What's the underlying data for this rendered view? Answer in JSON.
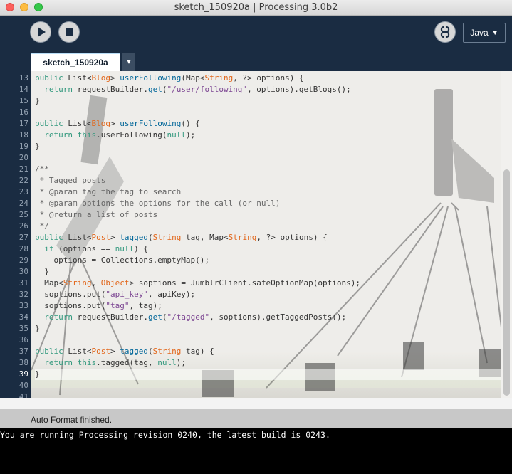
{
  "window": {
    "title": "sketch_150920a | Processing 3.0b2"
  },
  "toolbar": {
    "run_icon": "play-icon",
    "stop_icon": "stop-icon",
    "mode_icon": "debug-icon",
    "language": "Java"
  },
  "tab": {
    "name": "sketch_150920a",
    "menu_glyph": "▾"
  },
  "editor": {
    "current_line": 39,
    "lines": [
      {
        "n": "13",
        "html": "<span class=\"kw\">public</span> List&lt;<span class=\"ty\">Blog</span>&gt; <span class=\"fn\">userFollowing</span>(Map&lt;<span class=\"ty\">String</span>, ?&gt; options) {"
      },
      {
        "n": "14",
        "html": "  <span class=\"kw\">return</span> requestBuilder.<span class=\"fn\">get</span>(<span class=\"str\">\"/user/following\"</span>, options).getBlogs();"
      },
      {
        "n": "15",
        "html": "}"
      },
      {
        "n": "16",
        "html": ""
      },
      {
        "n": "17",
        "html": "<span class=\"kw\">public</span> List&lt;<span class=\"ty\">Blog</span>&gt; <span class=\"fn\">userFollowing</span>() {"
      },
      {
        "n": "18",
        "html": "  <span class=\"kw\">return</span> <span class=\"kw\">this</span>.userFollowing(<span class=\"lit\">null</span>);"
      },
      {
        "n": "19",
        "html": "}"
      },
      {
        "n": "20",
        "html": ""
      },
      {
        "n": "21",
        "html": "<span class=\"com\">/**</span>"
      },
      {
        "n": "22",
        "html": "<span class=\"com\"> * Tagged posts</span>"
      },
      {
        "n": "23",
        "html": "<span class=\"com\"> * @param tag the tag to search</span>"
      },
      {
        "n": "24",
        "html": "<span class=\"com\"> * @param options the options for the call (or null)</span>"
      },
      {
        "n": "25",
        "html": "<span class=\"com\"> * @return a list of posts</span>"
      },
      {
        "n": "26",
        "html": "<span class=\"com\"> */</span>"
      },
      {
        "n": "27",
        "html": "<span class=\"kw\">public</span> List&lt;<span class=\"ty\">Post</span>&gt; <span class=\"fn\">tagged</span>(<span class=\"ty\">String</span> tag, Map&lt;<span class=\"ty\">String</span>, ?&gt; options) {"
      },
      {
        "n": "28",
        "html": "  <span class=\"kw\">if</span> (options == <span class=\"lit\">null</span>) {"
      },
      {
        "n": "29",
        "html": "    options = Collections.emptyMap();"
      },
      {
        "n": "30",
        "html": "  }"
      },
      {
        "n": "31",
        "html": "  Map&lt;<span class=\"ty\">String</span>, <span class=\"ty\">Object</span>&gt; soptions = JumblrClient.safeOptionMap(options);"
      },
      {
        "n": "32",
        "html": "  soptions.put(<span class=\"str\">\"api_key\"</span>, apiKey);"
      },
      {
        "n": "33",
        "html": "  soptions.put(<span class=\"str\">\"tag\"</span>, tag);"
      },
      {
        "n": "34",
        "html": "  <span class=\"kw\">return</span> requestBuilder.<span class=\"fn\">get</span>(<span class=\"str\">\"/tagged\"</span>, soptions).getTaggedPosts();"
      },
      {
        "n": "35",
        "html": "}"
      },
      {
        "n": "36",
        "html": ""
      },
      {
        "n": "37",
        "html": "<span class=\"kw\">public</span> List&lt;<span class=\"ty\">Post</span>&gt; <span class=\"fn\">tagged</span>(<span class=\"ty\">String</span> tag) {"
      },
      {
        "n": "38",
        "html": "  <span class=\"kw\">return</span> <span class=\"kw\">this</span>.tagged(tag, <span class=\"lit\">null</span>);"
      },
      {
        "n": "39",
        "html": "}"
      },
      {
        "n": "40",
        "html": ""
      },
      {
        "n": "41",
        "html": ""
      }
    ]
  },
  "status": {
    "message": "Auto Format finished."
  },
  "console": {
    "text": "You are running Processing revision 0240, the latest build is 0243."
  }
}
